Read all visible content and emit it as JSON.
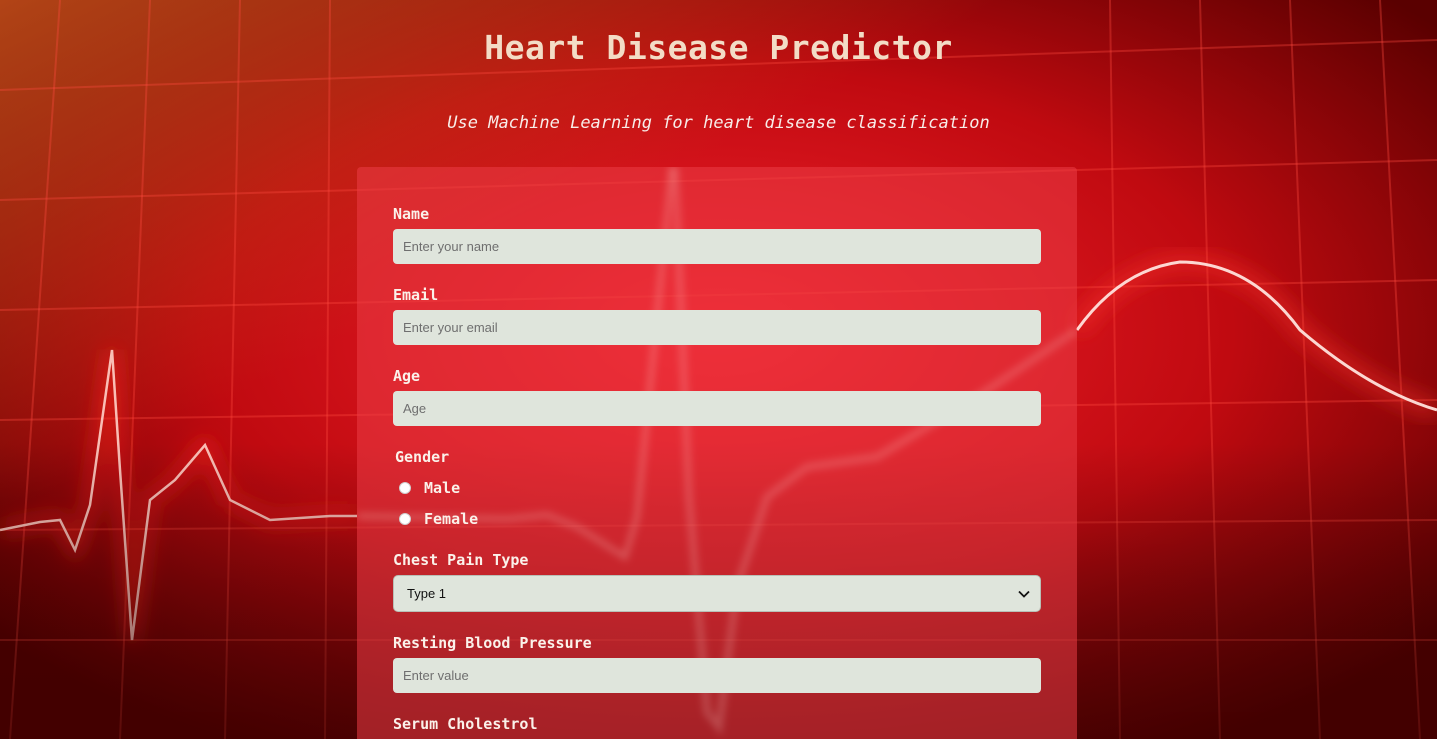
{
  "header": {
    "title": "Heart Disease Predictor",
    "subtitle": "Use Machine Learning for heart disease classification"
  },
  "form": {
    "name": {
      "label": "Name",
      "placeholder": "Enter your name",
      "value": ""
    },
    "email": {
      "label": "Email",
      "placeholder": "Enter your email",
      "value": ""
    },
    "age": {
      "label": "Age",
      "placeholder": "Age",
      "value": ""
    },
    "gender": {
      "label": "Gender",
      "options": [
        "Male",
        "Female"
      ],
      "selected": null
    },
    "chest_pain_type": {
      "label": "Chest Pain Type",
      "selected": "Type 1",
      "icon": "chevron-down-icon"
    },
    "resting_bp": {
      "label": "Resting Blood Pressure",
      "placeholder": "Enter value",
      "value": ""
    },
    "serum_cholesterol": {
      "label": "Serum Cholestrol"
    }
  },
  "colors": {
    "title": "#f3dcc6",
    "card": "rgba(235,60,70,0.55)",
    "input_bg": "#dfe5dc",
    "background": "#b00000"
  }
}
